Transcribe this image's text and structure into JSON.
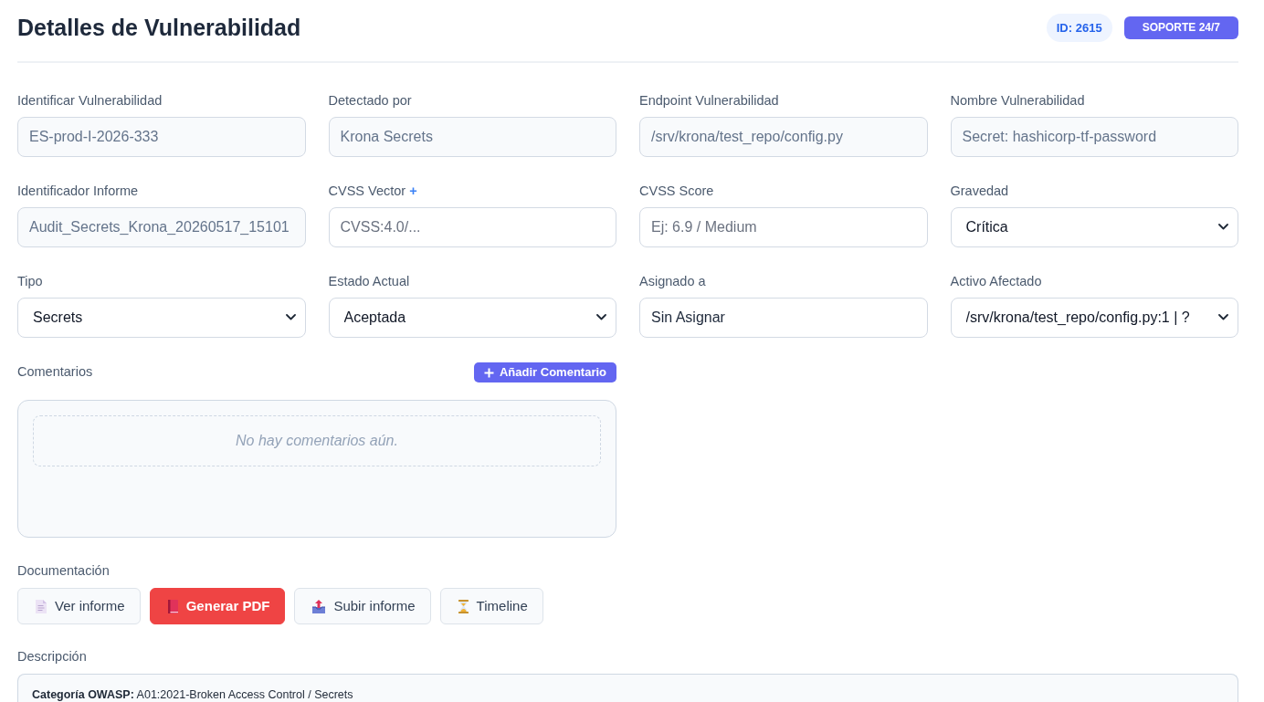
{
  "header": {
    "title": "Detalles de Vulnerabilidad",
    "id_badge": "ID: 2615",
    "support_badge": "SOPORTE 24/7"
  },
  "fields": [
    {
      "label": "Identificar Vulnerabilidad",
      "kind": "readonly",
      "value": "ES-prod-I-2026-333"
    },
    {
      "label": "Detectado por",
      "kind": "readonly",
      "value": "Krona Secrets"
    },
    {
      "label": "Endpoint Vulnerabilidad",
      "kind": "readonly",
      "value": "/srv/krona/test_repo/config.py"
    },
    {
      "label": "Nombre Vulnerabilidad",
      "kind": "readonly",
      "value": "Secret: hashicorp-tf-password"
    },
    {
      "label": "Identificador Informe",
      "kind": "readonly",
      "value": "Audit_Secrets_Krona_20260517_15101"
    },
    {
      "label": "CVSS Vector",
      "label_action": "+",
      "kind": "input",
      "placeholder": "CVSS:4.0/..."
    },
    {
      "label": "CVSS Score",
      "kind": "input",
      "placeholder": "Ej: 6.9 / Medium"
    },
    {
      "label": "Gravedad",
      "kind": "select",
      "value": "Crítica"
    },
    {
      "label": "Tipo",
      "kind": "select",
      "value": "Secrets"
    },
    {
      "label": "Estado Actual",
      "kind": "select",
      "value": "Aceptada"
    },
    {
      "label": "Asignado a",
      "kind": "input",
      "value": "Sin Asignar"
    },
    {
      "label": "Activo Afectado",
      "kind": "select",
      "value": "/srv/krona/test_repo/config.py:1 | ?"
    }
  ],
  "comments": {
    "label": "Comentarios",
    "add_button": "Añadir Comentario",
    "empty_text": "No hay comentarios aún."
  },
  "documentation": {
    "label": "Documentación",
    "buttons": [
      {
        "label": "Ver informe",
        "kind": "light"
      },
      {
        "label": "Generar PDF",
        "kind": "danger"
      },
      {
        "label": "Subir informe",
        "kind": "light"
      },
      {
        "label": "Timeline",
        "kind": "light"
      }
    ]
  },
  "description": {
    "label": "Descripción",
    "text": "**Categoría OWASP:** A01:2021-Broken Access Control / Secrets"
  }
}
